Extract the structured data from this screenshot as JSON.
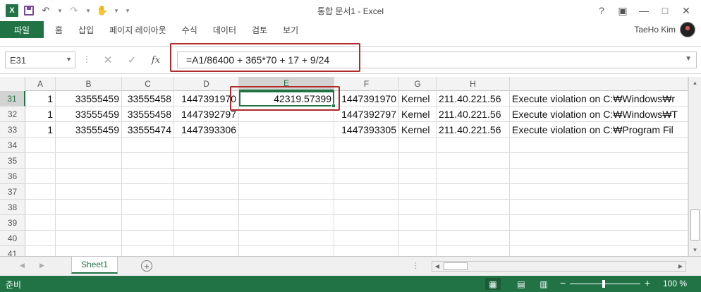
{
  "window": {
    "title": "통합 문서1 - Excel",
    "help": "?",
    "restore_ribbon": "▣",
    "minimize": "—",
    "maximize": "□",
    "close": "✕"
  },
  "qat": {
    "app_icon": "excel-logo-icon",
    "logo_text": "X",
    "undo": "↶",
    "redo": "↷",
    "touch": "✋",
    "customize": "▾"
  },
  "ribbon": {
    "file_tab": "파일",
    "tabs": [
      "홈",
      "삽입",
      "페이지 레이아웃",
      "수식",
      "데이터",
      "검토",
      "보기"
    ],
    "user_name": "TaeHo Kim"
  },
  "formula_bar": {
    "name_box": "E31",
    "dots": "⋮",
    "cancel": "✕",
    "enter": "✓",
    "fx": "fx",
    "formula": "=A1/86400 + 365*70 + 17 + 9/24"
  },
  "grid": {
    "columns": [
      {
        "label": "A",
        "active": false
      },
      {
        "label": "B",
        "active": false
      },
      {
        "label": "C",
        "active": false
      },
      {
        "label": "D",
        "active": false
      },
      {
        "label": "E",
        "active": true
      },
      {
        "label": "F",
        "active": false
      },
      {
        "label": "G",
        "active": false
      },
      {
        "label": "H",
        "active": false
      },
      {
        "label": "",
        "active": false
      }
    ],
    "rows": [
      {
        "num": "31",
        "active": true,
        "cells": [
          "1",
          "33555459",
          "33555458",
          "1447391970",
          "42319.57399",
          "1447391970",
          "Kernel",
          "211.40.221.56",
          "Execute violation on C:₩Windows₩r"
        ]
      },
      {
        "num": "32",
        "active": false,
        "cells": [
          "1",
          "33555459",
          "33555458",
          "1447392797",
          "",
          "1447392797",
          "Kernel",
          "211.40.221.56",
          "Execute violation on C:₩Windows₩T"
        ]
      },
      {
        "num": "33",
        "active": false,
        "cells": [
          "1",
          "33555459",
          "33555474",
          "1447393306",
          "",
          "1447393305",
          "Kernel",
          "211.40.221.56",
          "Execute violation on C:₩Program Fil"
        ]
      },
      {
        "num": "34",
        "active": false,
        "cells": [
          "",
          "",
          "",
          "",
          "",
          "",
          "",
          "",
          ""
        ]
      },
      {
        "num": "35",
        "active": false,
        "cells": [
          "",
          "",
          "",
          "",
          "",
          "",
          "",
          "",
          ""
        ]
      },
      {
        "num": "36",
        "active": false,
        "cells": [
          "",
          "",
          "",
          "",
          "",
          "",
          "",
          "",
          ""
        ]
      },
      {
        "num": "37",
        "active": false,
        "cells": [
          "",
          "",
          "",
          "",
          "",
          "",
          "",
          "",
          ""
        ]
      },
      {
        "num": "38",
        "active": false,
        "cells": [
          "",
          "",
          "",
          "",
          "",
          "",
          "",
          "",
          ""
        ]
      },
      {
        "num": "39",
        "active": false,
        "cells": [
          "",
          "",
          "",
          "",
          "",
          "",
          "",
          "",
          ""
        ]
      },
      {
        "num": "40",
        "active": false,
        "cells": [
          "",
          "",
          "",
          "",
          "",
          "",
          "",
          "",
          ""
        ]
      },
      {
        "num": "41",
        "active": false,
        "cells": [
          "",
          "",
          "",
          "",
          "",
          "",
          "",
          "",
          ""
        ]
      }
    ]
  },
  "sheets": {
    "active": "Sheet1",
    "add": "+",
    "nav_prev": "◀",
    "nav_next": "▶",
    "dots": "⋮"
  },
  "scroll": {
    "up": "▲",
    "down": "▼",
    "left": "◀",
    "right": "▶"
  },
  "status": {
    "text": "준비",
    "view_normal": "▦",
    "view_layout": "▤",
    "view_pagebreak": "▥",
    "zoom_minus": "−",
    "zoom_plus": "+",
    "zoom": "100 %"
  },
  "colors": {
    "accent": "#217346",
    "highlight": "#b02a2a"
  }
}
